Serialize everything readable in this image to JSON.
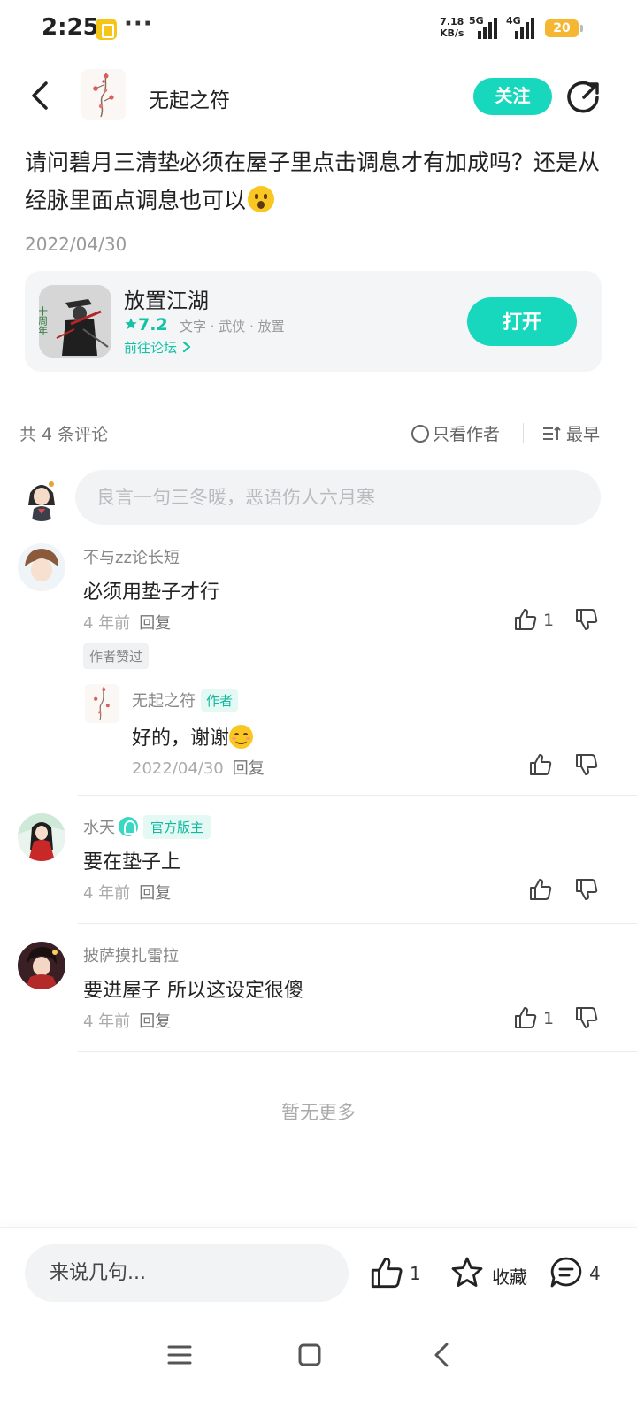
{
  "status_bar": {
    "time": "2:25",
    "dots": "···",
    "speed_value": "7.18",
    "speed_unit": "KB/s",
    "network1": "5G",
    "network2": "4G",
    "battery": "20"
  },
  "header": {
    "author_name": "无起之符",
    "follow_label": "关注"
  },
  "post": {
    "title": "请问碧月三清垫必须在屋子里点击调息才有加成吗？还是从经脉里面点调息也可以",
    "date": "2022/04/30"
  },
  "game": {
    "name": "放置江湖",
    "rating": "7.2",
    "tags": "文字 · 武侠 · 放置",
    "forum_link": "前往论坛",
    "open_label": "打开",
    "icon_text": "十周年"
  },
  "comments_header": {
    "count_label": "共 4 条评论",
    "only_author_label": "只看作者",
    "sort_label": "最早"
  },
  "comment_input": {
    "placeholder": "良言一句三冬暖，恶语伤人六月寒"
  },
  "comments": [
    {
      "name": "不与zz论长短",
      "text": "必须用垫子才行",
      "time": "4 年前",
      "reply_label": "回复",
      "likes": "1",
      "tag": "作者赞过",
      "replies": [
        {
          "name": "无起之符",
          "badge": "作者",
          "text": "好的，谢谢",
          "time": "2022/04/30",
          "reply_label": "回复"
        }
      ]
    },
    {
      "name": "水天",
      "badge": "官方版主",
      "text": "要在垫子上",
      "time": "4 年前",
      "reply_label": "回复"
    },
    {
      "name": "披萨摸扎雷拉",
      "text": "要进屋子 所以这设定很傻",
      "time": "4 年前",
      "reply_label": "回复",
      "likes": "1"
    }
  ],
  "no_more_label": "暂无更多",
  "bottom_bar": {
    "input_placeholder": "来说几句...",
    "like_count": "1",
    "favorite_label": "收藏",
    "comment_count": "4"
  },
  "colors": {
    "accent": "#17d7bc",
    "accent_text": "#12c3a6",
    "battery": "#f5b731"
  }
}
